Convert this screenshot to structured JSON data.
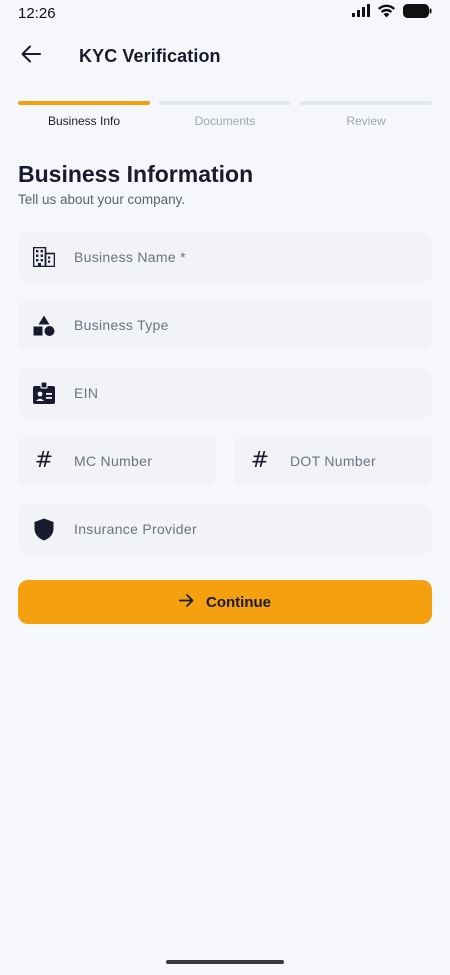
{
  "status_bar": {
    "time": "12:26"
  },
  "app_bar": {
    "title": "KYC Verification"
  },
  "stepper": {
    "steps": [
      {
        "label": "Business Info",
        "active": true
      },
      {
        "label": "Documents",
        "active": false
      },
      {
        "label": "Review",
        "active": false
      }
    ]
  },
  "form": {
    "title": "Business Information",
    "subtitle": "Tell us about your company.",
    "fields": {
      "business_name": {
        "placeholder": "Business Name *",
        "value": "",
        "icon": "building-icon"
      },
      "business_type": {
        "placeholder": "Business Type",
        "value": "",
        "icon": "category-icon"
      },
      "ein": {
        "placeholder": "EIN",
        "value": "",
        "icon": "id-badge-icon"
      },
      "mc_number": {
        "placeholder": "MC Number",
        "value": "",
        "icon": "hash-icon"
      },
      "dot_number": {
        "placeholder": "DOT Number",
        "value": "",
        "icon": "hash-icon"
      },
      "insurance_provider": {
        "placeholder": "Insurance Provider",
        "value": "",
        "icon": "shield-icon"
      }
    },
    "hash_symbol": "#"
  },
  "continue_button": {
    "label": "Continue",
    "icon": "arrow-right-icon"
  },
  "colors": {
    "accent": "#f5a00e",
    "background": "#f5f7fa",
    "field_background": "#f1f3f6",
    "text_primary": "#1a1a2e",
    "step_inactive": "#e3e7ee"
  }
}
